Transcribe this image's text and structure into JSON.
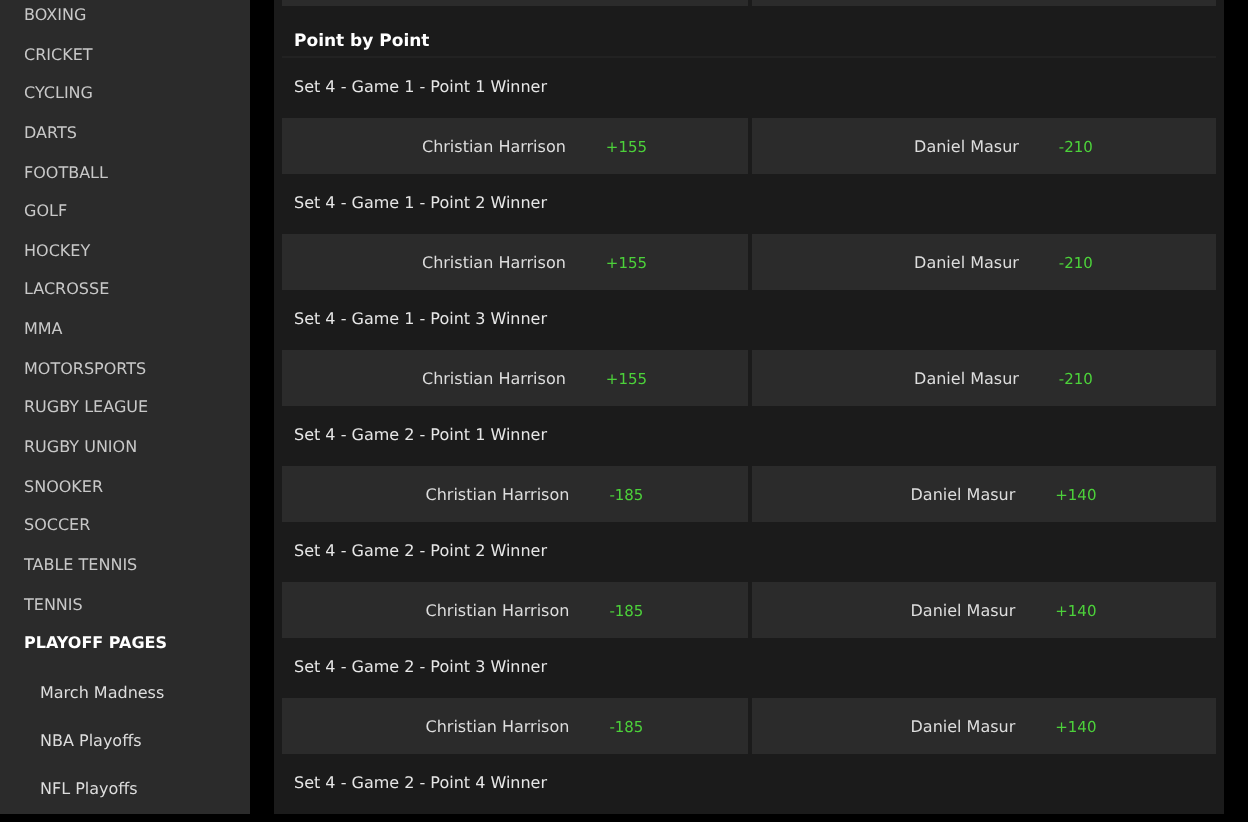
{
  "sidebar": {
    "items": [
      {
        "label": "BOXING",
        "kind": "sport"
      },
      {
        "label": "CRICKET",
        "kind": "sport"
      },
      {
        "label": "CYCLING",
        "kind": "sport"
      },
      {
        "label": "DARTS",
        "kind": "sport"
      },
      {
        "label": "FOOTBALL",
        "kind": "sport"
      },
      {
        "label": "GOLF",
        "kind": "sport"
      },
      {
        "label": "HOCKEY",
        "kind": "sport"
      },
      {
        "label": "LACROSSE",
        "kind": "sport"
      },
      {
        "label": "MMA",
        "kind": "sport"
      },
      {
        "label": "MOTORSPORTS",
        "kind": "sport"
      },
      {
        "label": "RUGBY LEAGUE",
        "kind": "sport"
      },
      {
        "label": "RUGBY UNION",
        "kind": "sport"
      },
      {
        "label": "SNOOKER",
        "kind": "sport"
      },
      {
        "label": "SOCCER",
        "kind": "sport"
      },
      {
        "label": "TABLE TENNIS",
        "kind": "sport"
      },
      {
        "label": "TENNIS",
        "kind": "sport"
      },
      {
        "label": "PLAYOFF PAGES",
        "kind": "heading"
      },
      {
        "label": "March Madness",
        "kind": "sub"
      },
      {
        "label": "NBA Playoffs",
        "kind": "sub"
      },
      {
        "label": "NFL Playoffs",
        "kind": "sub"
      }
    ]
  },
  "section": {
    "title": "Point by Point",
    "markets": [
      {
        "title": "Set 4 - Game 1 - Point 1 Winner",
        "selections": [
          {
            "name": "Christian Harrison",
            "odds": "+155"
          },
          {
            "name": "Daniel Masur",
            "odds": "-210"
          }
        ]
      },
      {
        "title": "Set 4 - Game 1 - Point 2 Winner",
        "selections": [
          {
            "name": "Christian Harrison",
            "odds": "+155"
          },
          {
            "name": "Daniel Masur",
            "odds": "-210"
          }
        ]
      },
      {
        "title": "Set 4 - Game 1 - Point 3 Winner",
        "selections": [
          {
            "name": "Christian Harrison",
            "odds": "+155"
          },
          {
            "name": "Daniel Masur",
            "odds": "-210"
          }
        ]
      },
      {
        "title": "Set 4 - Game 2 - Point 1 Winner",
        "selections": [
          {
            "name": "Christian Harrison",
            "odds": "-185"
          },
          {
            "name": "Daniel Masur",
            "odds": "+140"
          }
        ]
      },
      {
        "title": "Set 4 - Game 2 - Point 2 Winner",
        "selections": [
          {
            "name": "Christian Harrison",
            "odds": "-185"
          },
          {
            "name": "Daniel Masur",
            "odds": "+140"
          }
        ]
      },
      {
        "title": "Set 4 - Game 2 - Point 3 Winner",
        "selections": [
          {
            "name": "Christian Harrison",
            "odds": "-185"
          },
          {
            "name": "Daniel Masur",
            "odds": "+140"
          }
        ]
      },
      {
        "title": "Set 4 - Game 2 - Point 4 Winner"
      }
    ]
  }
}
